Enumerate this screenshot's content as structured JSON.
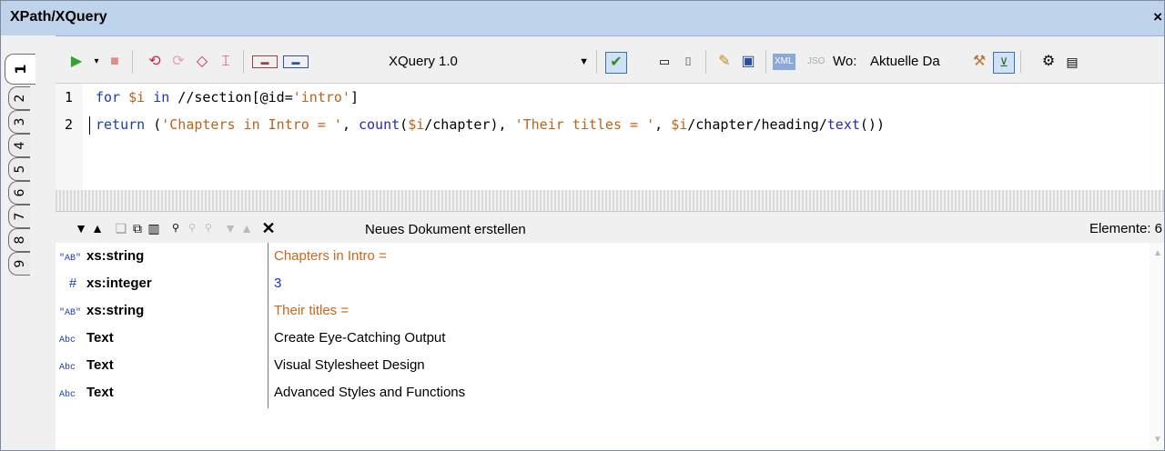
{
  "window": {
    "title": "XPath/XQuery",
    "close_symbol": "×"
  },
  "tabs": [
    {
      "label": "1",
      "active": true
    },
    {
      "label": "2"
    },
    {
      "label": "3"
    },
    {
      "label": "4"
    },
    {
      "label": "5"
    },
    {
      "label": "6"
    },
    {
      "label": "7"
    },
    {
      "label": "8"
    },
    {
      "label": "9"
    }
  ],
  "toolbar": {
    "language": "XQuery 1.0",
    "mode_label": "Wo:",
    "context_label": "Aktuelle Da",
    "xml_badge": "XML",
    "json_badge": "JSO"
  },
  "editor": {
    "lines": [
      {
        "number": "1",
        "text": "for $i in //section[@id='intro']"
      },
      {
        "number": "2",
        "text": "return ('Chapters in Intro = ', count($i/chapter), 'Their titles = ', $i/chapter/heading/text())"
      }
    ]
  },
  "results_toolbar": {
    "new_document": "Neues Dokument erstellen",
    "count_label": "Elemente: 6"
  },
  "results": [
    {
      "icon": "\"AB\"",
      "type": "xs:string",
      "value": "Chapters in Intro =",
      "color": "#c8671a"
    },
    {
      "icon": "#",
      "type": "xs:integer",
      "value": "3",
      "color": "#1a2fd0"
    },
    {
      "icon": "\"AB\"",
      "type": "xs:string",
      "value": "Their titles =",
      "color": "#c8671a"
    },
    {
      "icon": "Abc",
      "type": "Text",
      "value": "Create Eye-Catching Output",
      "color": "#000000"
    },
    {
      "icon": "Abc",
      "type": "Text",
      "value": "Visual Stylesheet Design",
      "color": "#000000"
    },
    {
      "icon": "Abc",
      "type": "Text",
      "value": "Advanced Styles and Functions",
      "color": "#000000"
    }
  ]
}
